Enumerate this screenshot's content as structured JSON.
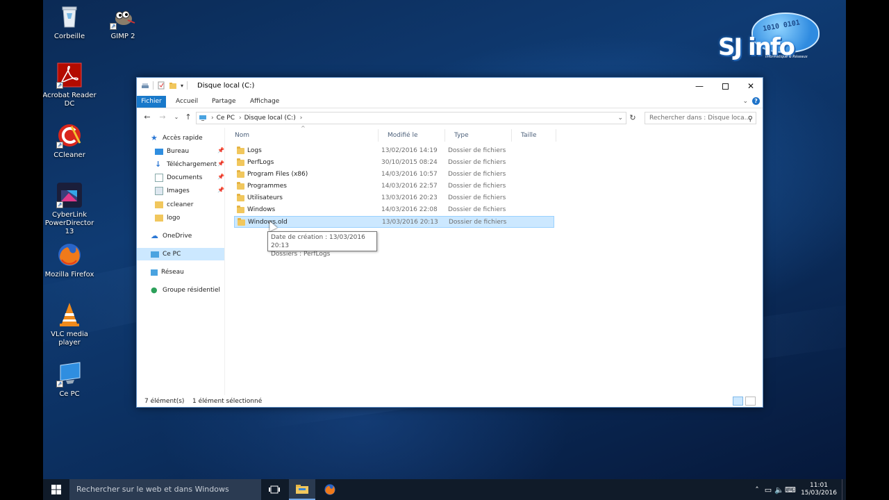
{
  "desktop": {
    "icons": [
      {
        "label": "Corbeille"
      },
      {
        "label": "GIMP 2"
      },
      {
        "label": "Acrobat Reader DC"
      },
      {
        "label": "CCleaner"
      },
      {
        "label": "CyberLink PowerDirector 13"
      },
      {
        "label": "Mozilla Firefox"
      },
      {
        "label": "VLC media player"
      },
      {
        "label": "Ce PC"
      }
    ],
    "logo": {
      "text": "SJ info",
      "tagline": "Informatique & Réseaux",
      "bits": "1010 0101"
    }
  },
  "window": {
    "title": "Disque local (C:)",
    "ribbon_tabs": [
      "Fichier",
      "Accueil",
      "Partage",
      "Affichage"
    ],
    "address": {
      "segments": [
        "Ce PC",
        "Disque local (C:)"
      ]
    },
    "search_placeholder": "Rechercher dans : Disque loca...",
    "nav": {
      "quick_access": "Accès rapide",
      "items": [
        "Bureau",
        "Téléchargements",
        "Documents",
        "Images",
        "ccleaner",
        "logo"
      ],
      "onedrive": "OneDrive",
      "this_pc": "Ce PC",
      "network": "Réseau",
      "homegroup": "Groupe résidentiel"
    },
    "columns": {
      "name": "Nom",
      "modified": "Modifié le",
      "type": "Type",
      "size": "Taille"
    },
    "files": [
      {
        "name": "Logs",
        "modified": "13/02/2016 14:19",
        "type": "Dossier de fichiers"
      },
      {
        "name": "PerfLogs",
        "modified": "30/10/2015 08:24",
        "type": "Dossier de fichiers"
      },
      {
        "name": "Program Files (x86)",
        "modified": "14/03/2016 10:57",
        "type": "Dossier de fichiers"
      },
      {
        "name": "Programmes",
        "modified": "14/03/2016 22:57",
        "type": "Dossier de fichiers"
      },
      {
        "name": "Utilisateurs",
        "modified": "13/03/2016 20:23",
        "type": "Dossier de fichiers"
      },
      {
        "name": "Windows",
        "modified": "14/03/2016 22:08",
        "type": "Dossier de fichiers"
      },
      {
        "name": "Windows.old",
        "modified": "13/03/2016 20:13",
        "type": "Dossier de fichiers"
      }
    ],
    "tooltip": {
      "line1": "Date de création : 13/03/2016 20:13",
      "line2": "Dossiers : PerfLogs"
    },
    "status": {
      "count": "7 élément(s)",
      "selected": "1 élément sélectionné"
    }
  },
  "taskbar": {
    "search_placeholder": "Rechercher sur le web et dans Windows",
    "time": "11:01",
    "date": "15/03/2016"
  },
  "colors": {
    "accent": "#1979ca",
    "selection": "#cce8ff",
    "taskbar": "#101b29"
  }
}
